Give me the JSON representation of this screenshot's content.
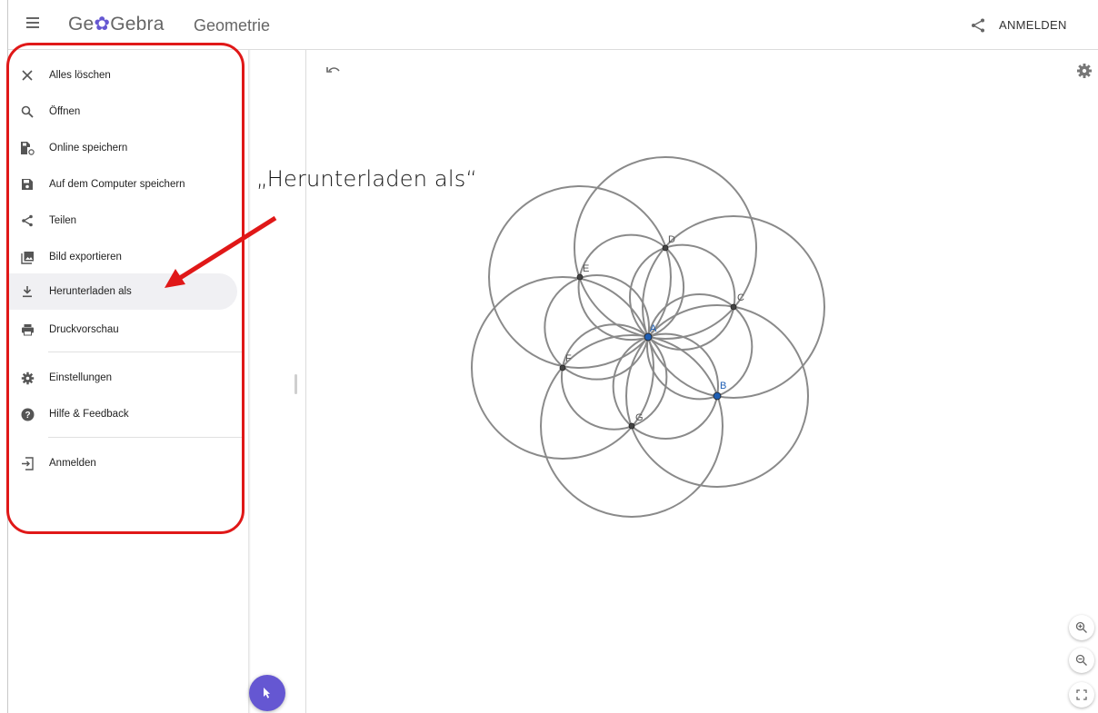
{
  "header": {
    "logo": "GeoGebra",
    "app_name": "Geometrie",
    "login_label": "ANMELDEN"
  },
  "menu": {
    "items": [
      {
        "label": "Alles löschen",
        "icon": "close-icon"
      },
      {
        "label": "Öffnen",
        "icon": "search-icon"
      },
      {
        "label": "Online speichern",
        "icon": "cloud-save-icon"
      },
      {
        "label": "Auf dem Computer speichern",
        "icon": "save-icon"
      },
      {
        "label": "Teilen",
        "icon": "share-icon"
      },
      {
        "label": "Bild exportieren",
        "icon": "image-icon"
      },
      {
        "label": "Herunterladen als",
        "icon": "download-icon",
        "active": true
      },
      {
        "label": "Druckvorschau",
        "icon": "print-icon"
      },
      {
        "label": "Einstellungen",
        "icon": "gear-icon"
      },
      {
        "label": "Hilfe & Feedback",
        "icon": "help-icon"
      },
      {
        "label": "Anmelden",
        "icon": "sign-in-icon"
      }
    ]
  },
  "annotation": {
    "text": "„Herunterladen als“",
    "color": "#e01818"
  },
  "geometry": {
    "points": [
      {
        "name": "A",
        "color": "#1f5fb4"
      },
      {
        "name": "B",
        "color": "#1f5fb4"
      },
      {
        "name": "C",
        "color": "#444444"
      },
      {
        "name": "D",
        "color": "#444444"
      },
      {
        "name": "E",
        "color": "#444444"
      },
      {
        "name": "F",
        "color": "#444444"
      },
      {
        "name": "G",
        "color": "#444444"
      }
    ],
    "circle_color": "#8a8a8a"
  },
  "colors": {
    "accent": "#6557d2",
    "annotation": "#e01818"
  }
}
